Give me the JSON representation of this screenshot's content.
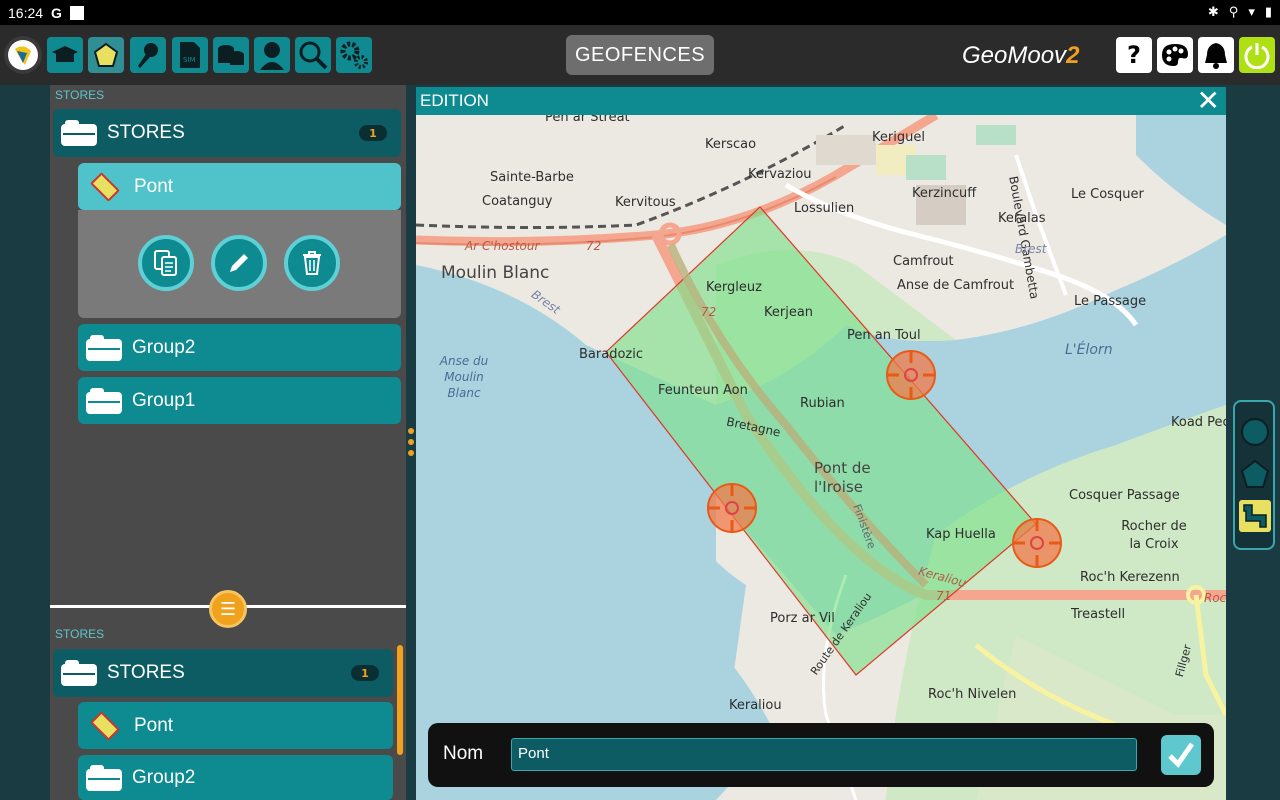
{
  "status_bar": {
    "time": "16:24",
    "g_label": "G"
  },
  "app": {
    "title": "GEOFENCES",
    "brand": "GeoMoov",
    "brand_suffix": "2",
    "toolbar_icons": [
      "app-logo-icon",
      "hat-icon",
      "geofence-icon",
      "microphone-icon",
      "sim-icon",
      "coins-icon",
      "person-icon",
      "search-icon",
      "settings-icon"
    ],
    "right_icons": [
      "help-icon",
      "palette-icon",
      "bell-icon",
      "power-icon"
    ],
    "colors": {
      "teal": "#0e8a91",
      "dark_teal": "#0d5c63",
      "orange": "#f0a21c",
      "geofence_fill": "#7fe08c",
      "geofence_border": "#e0362a",
      "power_green": "#aee014"
    }
  },
  "top_panel": {
    "section_label": "STORES",
    "folder": {
      "name": "STORES",
      "count": "1"
    },
    "items": [
      {
        "name": "Pont",
        "type": "polygon",
        "selected": true
      },
      {
        "name": "Group2",
        "type": "folder"
      },
      {
        "name": "Group1",
        "type": "folder"
      }
    ],
    "actions": [
      "copy-icon",
      "edit-icon",
      "delete-icon"
    ]
  },
  "bottom_panel": {
    "section_label": "STORES",
    "folder": {
      "name": "STORES",
      "count": "1"
    },
    "items": [
      {
        "name": "Pont",
        "type": "polygon"
      },
      {
        "name": "Group2",
        "type": "folder"
      }
    ]
  },
  "edition": {
    "title": "EDITION",
    "nom_label": "Nom",
    "nom_value": "Pont"
  },
  "map": {
    "labels": {
      "pen_ar_streat": "Pen ar Streat",
      "kerscao": "Kerscao",
      "keriguel": "Keriguel",
      "boulevard_gambetta": "Boulevard Gambetta",
      "sainte_barbe": "Sainte-Barbe",
      "kervaziou": "Kervaziou",
      "coatanguy": "Coatanguy",
      "kervitous": "Kervitous",
      "lossulien": "Lossulien",
      "kerzincuff": "Kerzincuff",
      "le_cosquer": "Le Cosquer",
      "keralas": "Keralas",
      "ar_chostour": "Ar C'hostour",
      "road_72a": "72",
      "brest_1": "Brest",
      "moulin_blanc": "Moulin Blanc",
      "camfrout": "Camfrout",
      "anse_de_camfrout": "Anse de Camfrout",
      "kergleuz": "Kergleuz",
      "brest_2": "Brest",
      "le_passage": "Le Passage",
      "road_72b": "72",
      "kerjean": "Kerjean",
      "pen_an_toul": "Pen an Toul",
      "baradozic": "Baradozic",
      "lelorn": "L'Élorn",
      "anse_du_moulin_blanc": "Anse du Moulin Blanc",
      "feunteun_aon": "Feunteun Aon",
      "rubian": "Rubian",
      "bretagne": "Bretagne",
      "koad_pech": "Koad Pec'h",
      "pont_de_liroise": "Pont de l'Iroise",
      "finistere": "Finistère",
      "kap_huella": "Kap Huella",
      "cosquer_passage": "Cosquer Passage",
      "rocher_de_la_croix": "Rocher de la Croix",
      "keraliou": "Keraliou",
      "road_71": "71",
      "rochr_kerezenn": "Roc'h Kerezenn",
      "roc": "Roc",
      "treastell": "Treastell",
      "porz_ar_vil": "Porz ar Vil",
      "route_de_keraliou": "Route de Keraliou",
      "roch_nivelen": "Roc'h Nivelen",
      "keraliou_2": "Keraliou",
      "fillger": "Fillger"
    }
  },
  "shape_palette": [
    "circle-tool-icon",
    "polygon-tool-icon",
    "route-tool-icon"
  ]
}
